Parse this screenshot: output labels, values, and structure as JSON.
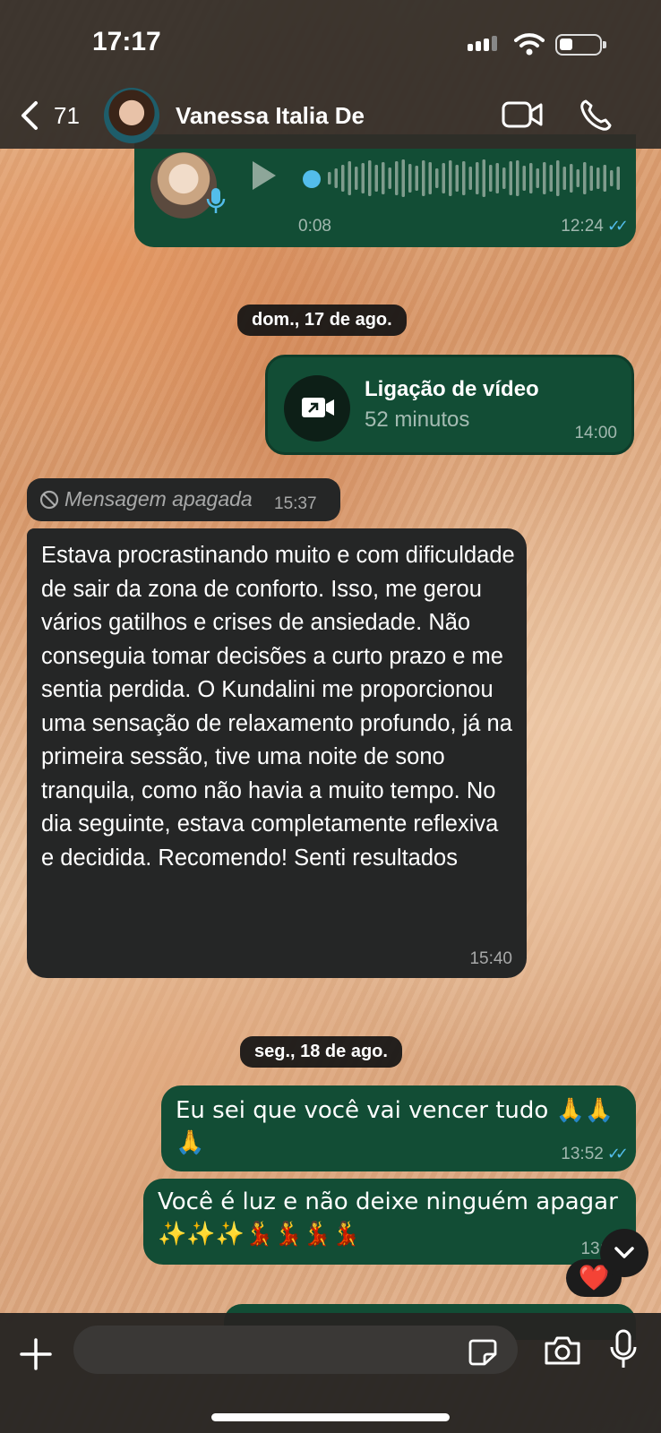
{
  "status_bar": {
    "time": "17:17"
  },
  "header": {
    "back_count": "71",
    "contact_name": "Vanessa Italia De"
  },
  "voice_message": {
    "duration": "0:08",
    "time": "12:24"
  },
  "dates": {
    "sunday": "dom., 17 de ago.",
    "monday": "seg., 18 de ago."
  },
  "video_call": {
    "title": "Ligação de vídeo",
    "subtitle": "52 minutos",
    "time": "14:00"
  },
  "deleted_message": {
    "text": "Mensagem apagada",
    "time": "15:37"
  },
  "incoming_message": {
    "text": "Estava procrastinando muito e com dificuldade de sair da zona de conforto. Isso, me gerou vários gatilhos e crises de ansiedade. Não conseguia tomar decisões a curto prazo e me sentia perdida. O Kundalini me proporcionou uma sensação de relaxamento profundo, já na primeira sessão, tive uma noite de sono tranquila, como não havia a muito tempo. No dia seguinte, estava completamente reflexiva e decidida. Recomendo! Senti resultados",
    "time": "15:40"
  },
  "outgoing_1": {
    "text": "Eu sei que você vai vencer tudo 🙏🙏🙏",
    "time": "13:52"
  },
  "outgoing_2": {
    "text": "Você é luz e não deixe ninguém apagar ✨✨✨💃💃💃💃",
    "time": "13:52"
  },
  "reaction": "❤️",
  "composer": {
    "placeholder": ""
  },
  "colors": {
    "outgoing_bubble": "#124d35",
    "incoming_bubble": "#252626",
    "read_ticks": "#53bdeb"
  },
  "icons": [
    "back-chevron-icon",
    "video-call-icon",
    "phone-icon",
    "play-icon",
    "mic-icon",
    "deleted-icon",
    "plus-icon",
    "sticker-icon",
    "camera-icon",
    "chevron-down-icon"
  ]
}
